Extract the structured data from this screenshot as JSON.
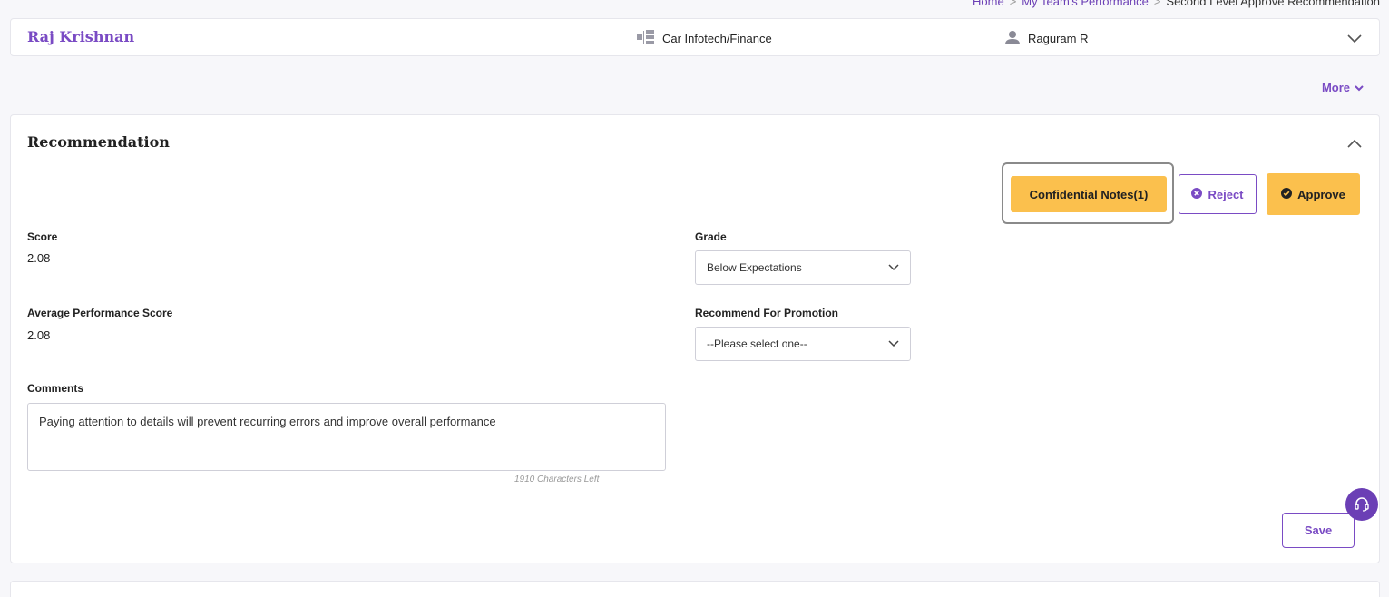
{
  "breadcrumb": {
    "items": [
      "Home",
      "My Team's Performance",
      "Second Level Approve Recommendation"
    ],
    "separator": ">"
  },
  "employee": {
    "name": "Raj Krishnan",
    "department": "Car Infotech/Finance",
    "department_icon": "org-chart-icon",
    "manager": "Raguram R",
    "manager_icon": "user-icon"
  },
  "more_label": "More",
  "recommendation": {
    "title": "Recommendation",
    "buttons": {
      "notes": "Confidential Notes(1)",
      "reject": "Reject",
      "approve": "Approve",
      "save": "Save"
    },
    "score_label": "Score",
    "score_value": "2.08",
    "avg_label": "Average Performance Score",
    "avg_value": "2.08",
    "grade_label": "Grade",
    "grade_value": "Below Expectations",
    "promotion_label": "Recommend For Promotion",
    "promotion_value": "--Please select one--",
    "comments_label": "Comments",
    "comments_value": "Paying attention to details will prevent recurring errors and improve overall performance",
    "chars_left": "1910 Characters Left"
  },
  "colors": {
    "brand_purple": "#7a4bc4",
    "accent_yellow": "#fbc04d",
    "fab_purple": "#6b3fb5"
  }
}
